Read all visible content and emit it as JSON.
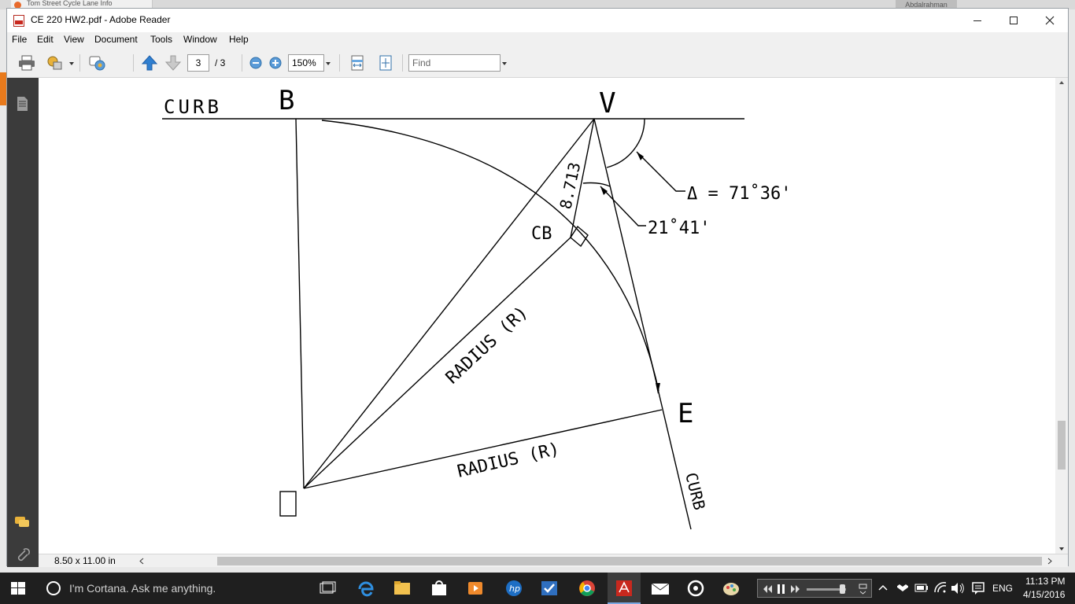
{
  "window": {
    "title": "CE 220 HW2.pdf - Adobe Reader",
    "background_tab_title": "Tom Street Cycle Lane Info",
    "background_user": "Abdalrahman"
  },
  "menu": [
    "File",
    "Edit",
    "View",
    "Document",
    "Tools",
    "Window",
    "Help"
  ],
  "toolbar": {
    "current_page": "3",
    "page_total": "/ 3",
    "zoom": "150%",
    "find_placeholder": "Find"
  },
  "status": {
    "page_size": "8.50 x 11.00 in"
  },
  "drawing": {
    "curb_top": "CURB",
    "point_b": "B",
    "point_v": "V",
    "delta_label": "Δ = 71˚36'",
    "angle_label": "21˚41'",
    "dimension": "8.713",
    "point_cb": "CB",
    "radius_label_1": "RADIUS (R)",
    "radius_label_2": "RADIUS (R)",
    "point_e": "E",
    "curb_bottom": "CURB"
  },
  "taskbar": {
    "cortana": "I'm Cortana. Ask me anything.",
    "language": "ENG",
    "time": "11:13 PM",
    "date": "4/15/2016"
  },
  "colors": {
    "taskbar": "#1f1f1f",
    "nav_pane": "#3b3b3b",
    "adobe_red": "#c8281e",
    "accent_blue": "#2f7fd0"
  }
}
